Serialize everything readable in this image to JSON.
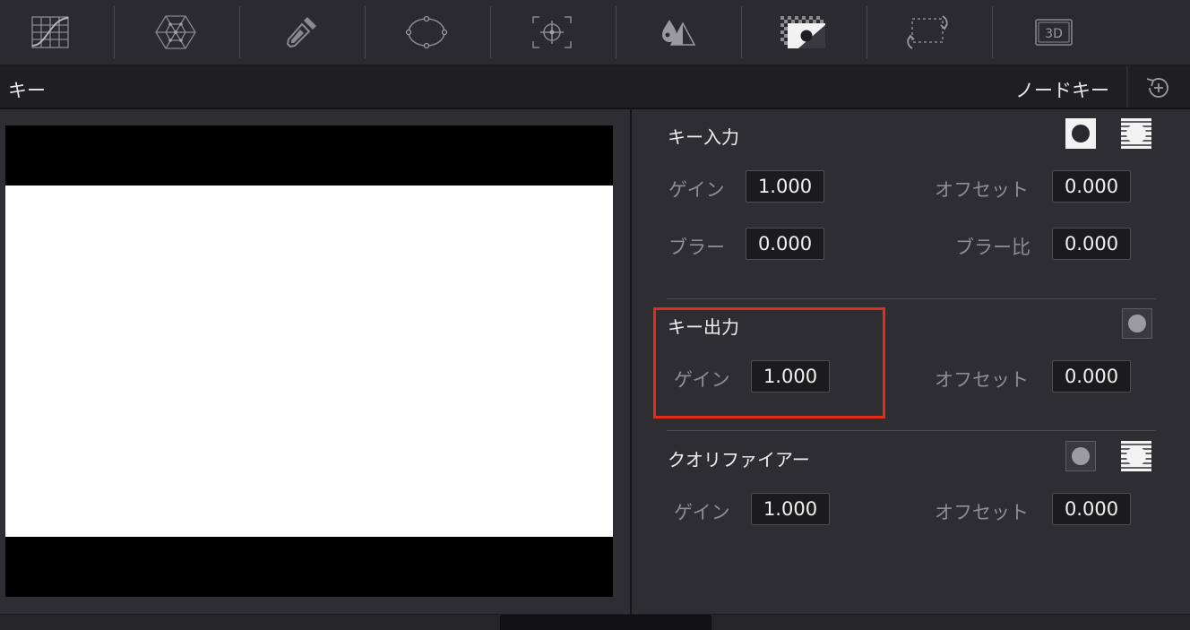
{
  "toolbar": {
    "tools": [
      {
        "icon": "curves-icon"
      },
      {
        "icon": "color-warper-icon"
      },
      {
        "icon": "qualifier-eyedropper-icon"
      },
      {
        "icon": "power-window-icon"
      },
      {
        "icon": "tracker-icon"
      },
      {
        "icon": "blur-icon"
      },
      {
        "icon": "key-icon",
        "active": true
      },
      {
        "icon": "sizing-icon"
      },
      {
        "icon": "3d-icon",
        "text": "3D"
      }
    ]
  },
  "header": {
    "title": "キー",
    "node_key_label": "ノードキー",
    "reset_icon": "reset-icon"
  },
  "key_input": {
    "title": "キー入力",
    "gain_label": "ゲイン",
    "gain_value": "1.000",
    "offset_label": "オフセット",
    "offset_value": "0.000",
    "blur_label": "ブラー",
    "blur_value": "0.000",
    "blur_ratio_label": "ブラー比",
    "blur_ratio_value": "0.000"
  },
  "key_output": {
    "title": "キー出力",
    "gain_label": "ゲイン",
    "gain_value": "1.000",
    "offset_label": "オフセット",
    "offset_value": "0.000"
  },
  "qualifier": {
    "title": "クオリファイアー",
    "gain_label": "ゲイン",
    "gain_value": "1.000",
    "offset_label": "オフセット",
    "offset_value": "0.000"
  },
  "colors": {
    "highlight": "#e52c1a",
    "panel_bg": "#2e2e32",
    "field_bg": "#1b1b1d"
  }
}
